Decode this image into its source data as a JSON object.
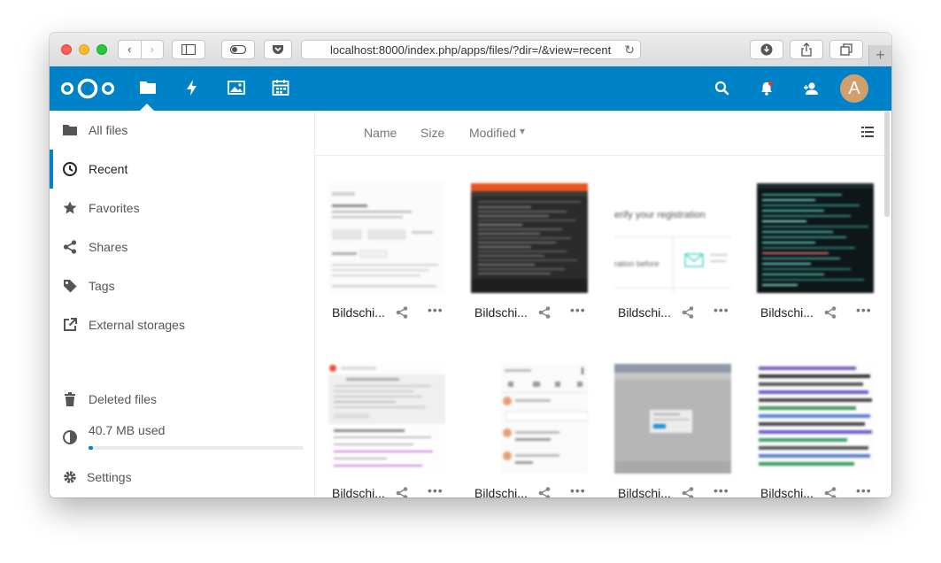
{
  "browser": {
    "url": "localhost:8000/index.php/apps/files/?dir=/&view=recent",
    "nav_back": "‹",
    "nav_forward": "›",
    "reload": "↻",
    "new_tab": "+"
  },
  "header": {
    "apps": [
      "Files",
      "Activity",
      "Gallery",
      "Calendar"
    ],
    "avatar_letter": "A",
    "brand_color": "#0082c9"
  },
  "sidebar": {
    "items": [
      {
        "label": "All files",
        "icon": "folder-icon"
      },
      {
        "label": "Recent",
        "icon": "clock-icon",
        "active": true
      },
      {
        "label": "Favorites",
        "icon": "star-icon"
      },
      {
        "label": "Shares",
        "icon": "share-icon"
      },
      {
        "label": "Tags",
        "icon": "tag-icon"
      },
      {
        "label": "External storages",
        "icon": "external-link-icon"
      }
    ],
    "deleted_files": "Deleted files",
    "quota": "40.7 MB used",
    "quota_fraction": 0.02,
    "settings": "Settings"
  },
  "columns": {
    "name": "Name",
    "size": "Size",
    "modified": "Modified",
    "sort_indicator": "▾"
  },
  "files": [
    {
      "name": "Bildschi..."
    },
    {
      "name": "Bildschi..."
    },
    {
      "name": "Bildschi..."
    },
    {
      "name": "Bildschi..."
    },
    {
      "name": "Bildschi..."
    },
    {
      "name": "Bildschi..."
    },
    {
      "name": "Bildschi..."
    },
    {
      "name": "Bildschi..."
    }
  ],
  "thumb_text": {
    "registration": "erify your registration",
    "ration_before": "ration before"
  }
}
